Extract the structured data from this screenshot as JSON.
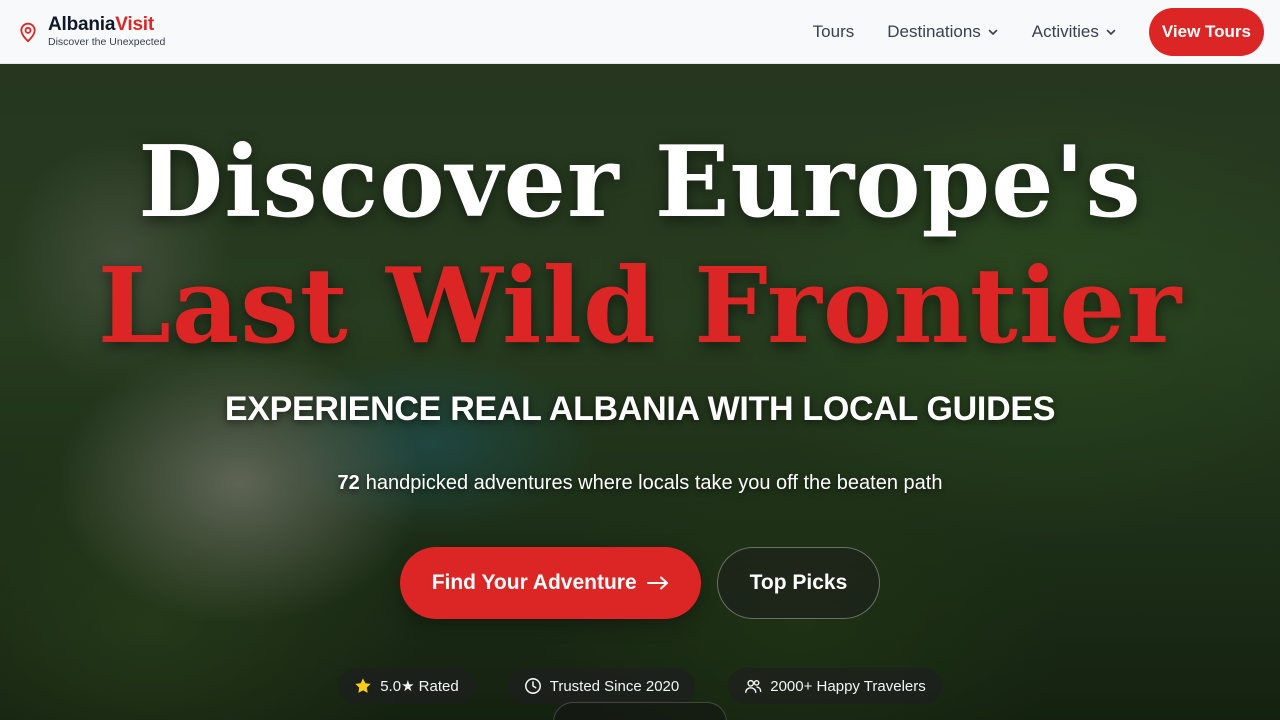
{
  "nav": {
    "brand_name_main": "Albania",
    "brand_name_accent": "Visit",
    "brand_tagline": "Discover the Unexpected",
    "links": [
      {
        "label": "Tours",
        "dropdown": false
      },
      {
        "label": "Destinations",
        "dropdown": true
      },
      {
        "label": "Activities",
        "dropdown": true
      }
    ],
    "cta_label": "View Tours"
  },
  "hero": {
    "headline_line1": "Discover Europe's",
    "headline_line2": "Last Wild Frontier",
    "subheadline": "EXPERIENCE REAL ALBANIA WITH LOCAL GUIDES",
    "tagline_count": "72",
    "tagline_text": "handpicked adventures where locals take you off the beaten path",
    "primary_cta": "Find Your Adventure",
    "secondary_cta": "Top Picks",
    "badges": [
      {
        "icon": "star-icon",
        "label": "5.0★ Rated"
      },
      {
        "icon": "clock-icon",
        "label": "Trusted Since 2020"
      },
      {
        "icon": "users-icon",
        "label": "2000+ Happy Travelers"
      }
    ]
  },
  "colors": {
    "accent": "#dc2626",
    "nav_bg": "#f8f9fb",
    "star": "#facc15"
  }
}
